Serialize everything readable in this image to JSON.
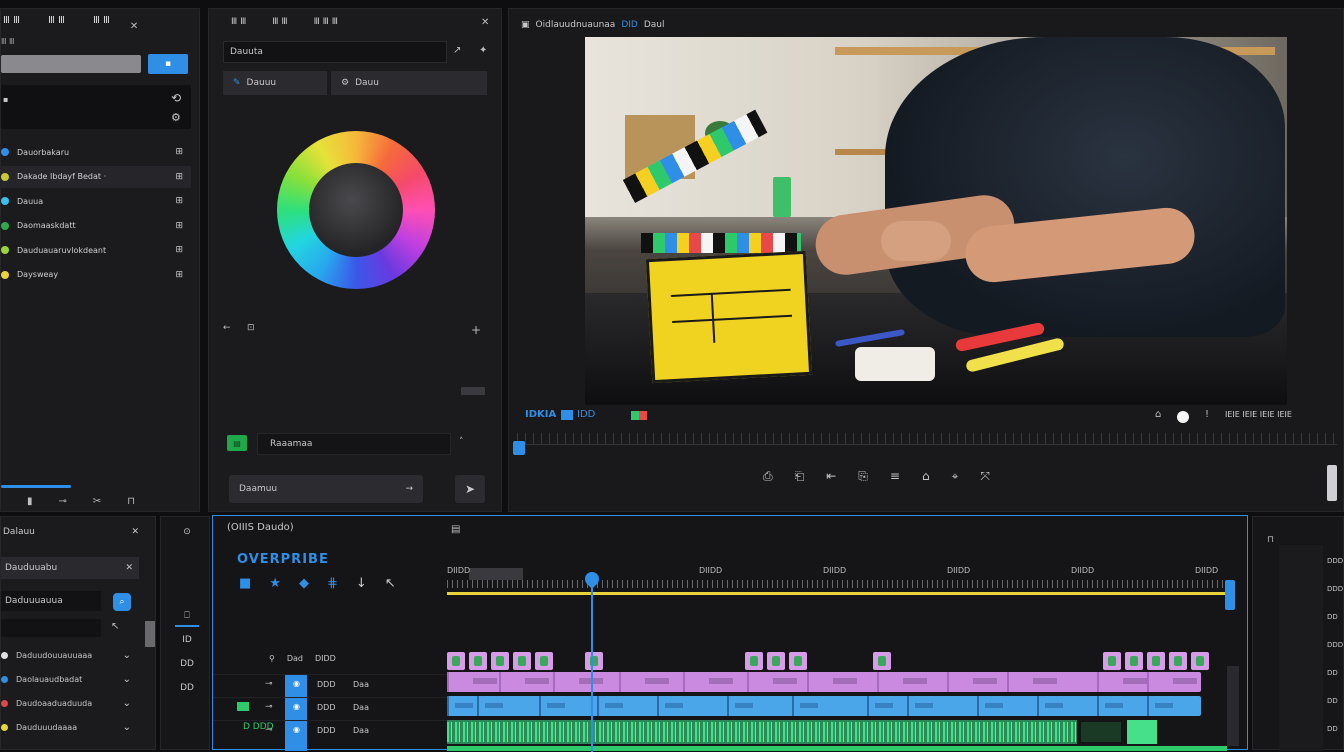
{
  "left_panel": {
    "tabs": [
      "Ⅲ Ⅲ",
      "Ⅲ Ⅲ",
      "Ⅲ Ⅲ"
    ],
    "search_button": "▪",
    "items": [
      {
        "label": "Dauorbakaru",
        "color": "#2f8fe6"
      },
      {
        "label": "Dakade Ibdayf Bedat ·",
        "color": "#c8c832"
      },
      {
        "label": "Dauua",
        "color": "#38c0e8"
      },
      {
        "label": "Daomaaskdatt",
        "color": "#2ea84a"
      },
      {
        "label": "Dauduauaruvlokdeant",
        "color": "#9ad43a"
      },
      {
        "label": "Daysweay",
        "color": "#e8d43a"
      }
    ]
  },
  "color_panel": {
    "tabs": [
      "Ⅲ Ⅲ",
      "Ⅲ Ⅲ",
      "Ⅲ Ⅲ Ⅲ"
    ],
    "field_label": "Dauuta",
    "subtabs": [
      "Dauuu",
      "Dauu"
    ],
    "preset_label": "Raaamaa",
    "apply_label": "Daamuu"
  },
  "viewer": {
    "title": "Oidlauudnuaunaa",
    "title_accent": "DID",
    "title_suffix": "Daul",
    "timecode": "IDKIA",
    "timecode_b": "IDD",
    "right_readout": "IEIE IEIE IEIE IEIE"
  },
  "effects_panel": {
    "title": "Dalauu",
    "search_value": "Dauduuabu",
    "search_btn": "Daduuuauua",
    "items": [
      {
        "label": "Daduudouuauuaaa",
        "color": "#e0e0e0"
      },
      {
        "label": "Daolauaudbadat",
        "color": "#2f8fe6"
      },
      {
        "label": "Daudoaaduaduuda",
        "color": "#e04848"
      },
      {
        "label": "Dauduuudaaaa",
        "color": "#e8d43a"
      }
    ]
  },
  "timeline": {
    "title": "(OIIIS Daudo)",
    "sequence_name": "OVERPRIBE",
    "ruler_labels": [
      "DIIDD",
      "DIIDD",
      "DIIDD",
      "DIIDD",
      "DIIDD",
      "DIIDD"
    ],
    "track_header": {
      "a": "Dad",
      "b": "DIDD"
    },
    "tracks": [
      {
        "name": "DDD",
        "sub": "Daa"
      },
      {
        "name": "DDD",
        "sub": "Daa"
      },
      {
        "name": "DDD",
        "sub": "Daa"
      }
    ],
    "track_time": "D DDD",
    "tools_left": [
      "⊙",
      "⎕",
      "ID",
      "DD",
      "DD"
    ]
  },
  "right_panel": {
    "labels": [
      "DDD",
      "DDD",
      "DD",
      "DDD",
      "DD",
      "DD",
      "DD"
    ]
  },
  "colors": {
    "accent": "#2f8fe6",
    "purple_clip": "#c98ae0",
    "blue_clip": "#4aa6e8",
    "green_clip": "#36c978",
    "playhead": "#2f8fe6",
    "workarea": "#e8d43a"
  }
}
